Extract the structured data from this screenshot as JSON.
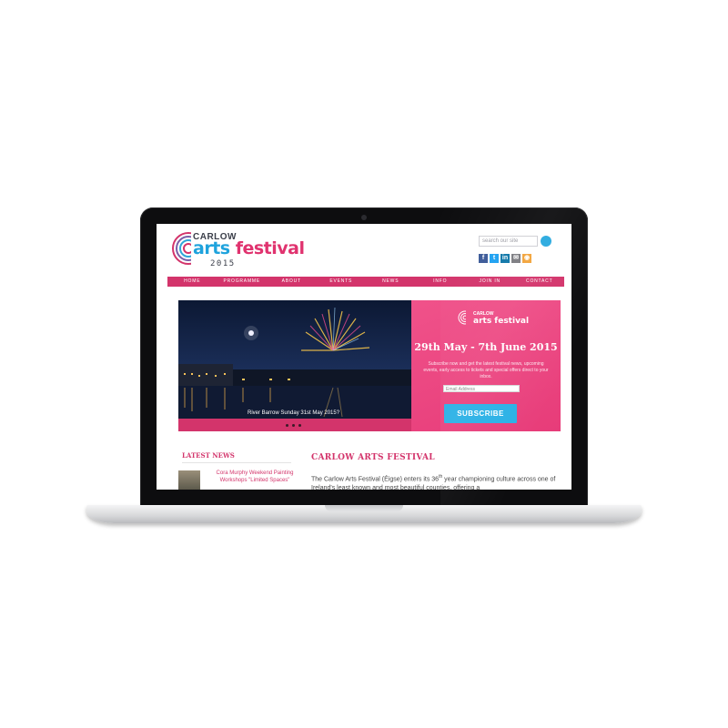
{
  "logo": {
    "carlow": "CARLOW",
    "arts_a": "arts",
    "arts_b": "festival",
    "year": "2015"
  },
  "search": {
    "placeholder": "search our site"
  },
  "socials": [
    {
      "icon": "facebook-icon",
      "glyph": "f",
      "color": "#3b5998"
    },
    {
      "icon": "twitter-icon",
      "glyph": "t",
      "color": "#1da1f2"
    },
    {
      "icon": "linkedin-icon",
      "glyph": "in",
      "color": "#0e76a8"
    },
    {
      "icon": "email-icon",
      "glyph": "✉",
      "color": "#7b7b80"
    },
    {
      "icon": "rss-icon",
      "glyph": "◉",
      "color": "#f2a33a"
    }
  ],
  "nav": [
    "HOME",
    "PROGRAMME",
    "ABOUT",
    "EVENTS",
    "NEWS",
    "INFO",
    "JOIN IN",
    "CONTACT"
  ],
  "hero": {
    "caption": "River Barrow Sunday 31st May 2015?"
  },
  "promo": {
    "carlow": "CARLOW",
    "arts": "arts festival",
    "date": "29th May - 7th June 2015",
    "text": "Subscribe now and get the latest festival news, upcoming events, early access to tickets and special offers direct to your inbox.",
    "email_placeholder": "Email Address",
    "subscribe": "SUBSCRIBE"
  },
  "latest_news": {
    "heading": "LATEST NEWS",
    "item": "Cora Murphy Weekend Painting Workshops \"Limited Spaces\""
  },
  "about": {
    "title": "CARLOW ARTS FESTIVAL",
    "text_a": "The Carlow Arts Festival (Éigse) enters its 36",
    "sup": "th",
    "text_b": " year championing culture across one of Ireland's least known and most beautiful counties, offering a"
  },
  "colors": {
    "brand_pink": "#d3346b",
    "promo_pink": "#ea4680",
    "accent_blue": "#2bb1e6"
  }
}
